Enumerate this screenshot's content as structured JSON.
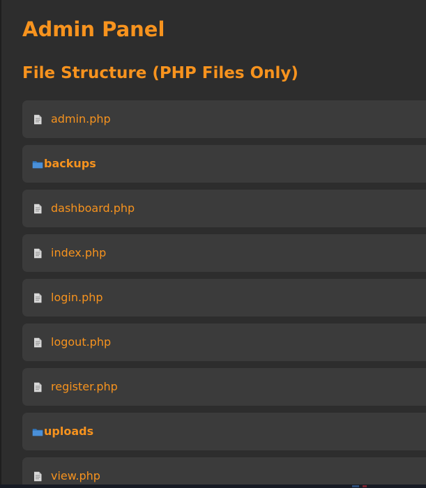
{
  "header": {
    "title": "Admin Panel"
  },
  "section": {
    "title": "File Structure (PHP Files Only)"
  },
  "items": [
    {
      "type": "file",
      "label": "admin.php",
      "icon": "file-icon"
    },
    {
      "type": "folder",
      "label": "backups",
      "icon": "folder-icon"
    },
    {
      "type": "file",
      "label": "dashboard.php",
      "icon": "file-icon"
    },
    {
      "type": "file",
      "label": "index.php",
      "icon": "file-icon"
    },
    {
      "type": "file",
      "label": "login.php",
      "icon": "file-icon"
    },
    {
      "type": "file",
      "label": "logout.php",
      "icon": "file-icon"
    },
    {
      "type": "file",
      "label": "register.php",
      "icon": "file-icon"
    },
    {
      "type": "folder",
      "label": "uploads",
      "icon": "folder-icon"
    },
    {
      "type": "file",
      "label": "view.php",
      "icon": "file-icon"
    }
  ],
  "colors": {
    "accent": "#f7931e",
    "background": "#2d2d2d",
    "item_background": "#3b3b3b",
    "folder_icon": "#4a90d9",
    "file_icon": "#d8d8d8"
  }
}
